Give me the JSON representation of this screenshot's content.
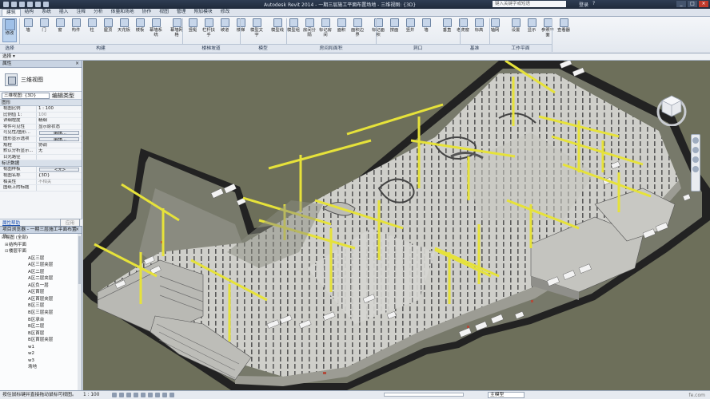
{
  "titlebar": {
    "title": "Autodesk Revit 2014 -      一期三层施工平面布置场地 - 三维视图: {3D}",
    "search_placeholder": "键入关键字或短语",
    "tools": [
      "登录",
      "?"
    ],
    "window_controls": [
      "_",
      "□",
      "×"
    ]
  },
  "tabs": [
    "建筑",
    "结构",
    "系统",
    "插入",
    "注释",
    "分析",
    "体量和场地",
    "协作",
    "视图",
    "管理",
    "附加模块",
    "修改"
  ],
  "active_tab": "建筑",
  "ribbon": {
    "modify": "修改",
    "buttons": [
      "墙",
      "门",
      "窗",
      "构件",
      "柱",
      "屋顶",
      "天花板",
      "楼板",
      "幕墙系统",
      "幕墙网格",
      "竖梃",
      "栏杆扶手",
      "坡道",
      "楼梯",
      "模型文字",
      "模型线",
      "模型组",
      "房间分隔",
      "标记房间",
      "面积",
      "面积边界",
      "标记面积",
      "按面",
      "竖井",
      "墙",
      "垂直",
      "老虎窗",
      "标高",
      "轴网",
      "设置",
      "显示",
      "参照平面",
      "查看器"
    ],
    "groups": [
      "选择",
      "构建",
      "楼梯坡道",
      "模型",
      "房间和面积",
      "洞口",
      "基准",
      "工作平面"
    ]
  },
  "optbar": {
    "label": "选择 ▾"
  },
  "properties": {
    "header": "属性",
    "type_name": "三维视图",
    "selector": "三维视图: {3D}",
    "edit_type": "编辑类型",
    "sections": [
      {
        "name": "图形",
        "rows": [
          {
            "k": "视图比例",
            "v": "1 : 100"
          },
          {
            "k": "比例值 1:",
            "v": "100",
            "dim": true
          },
          {
            "k": "详细程度",
            "v": "精细"
          },
          {
            "k": "零件可见性",
            "v": "显示原状态"
          },
          {
            "k": "可见性/图形...",
            "v": "编辑...",
            "btn": true
          },
          {
            "k": "图形显示选项",
            "v": "编辑...",
            "btn": true
          },
          {
            "k": "规程",
            "v": "协调"
          },
          {
            "k": "默认分析显示...",
            "v": "无"
          },
          {
            "k": "日光路径",
            "v": ""
          }
        ]
      },
      {
        "name": "标识数据",
        "rows": [
          {
            "k": "视图样板",
            "v": "<无>",
            "btn": true
          },
          {
            "k": "视图名称",
            "v": "{3D}"
          },
          {
            "k": "相关性",
            "v": "不相关",
            "dim": true
          },
          {
            "k": "图纸上的标题",
            "v": ""
          }
        ]
      }
    ],
    "help_link": "属性帮助",
    "apply": "应用"
  },
  "browser": {
    "header": "项目浏览器 - 一期三层施工平面布置场...",
    "nodes": [
      {
        "t": "视图 (全部)",
        "lvl": 0,
        "tg": "⊟"
      },
      {
        "t": "结构平面",
        "lvl": 1,
        "tg": "⊞"
      },
      {
        "t": "楼层平面",
        "lvl": 1,
        "tg": "⊟"
      },
      {
        "t": "A区三层",
        "lvl": 3,
        "tg": ""
      },
      {
        "t": "A区三层夹层",
        "lvl": 3,
        "tg": ""
      },
      {
        "t": "A区二层",
        "lvl": 3,
        "tg": ""
      },
      {
        "t": "A区二层夹层",
        "lvl": 3,
        "tg": ""
      },
      {
        "t": "A区负一层",
        "lvl": 3,
        "tg": ""
      },
      {
        "t": "A区首层",
        "lvl": 3,
        "tg": ""
      },
      {
        "t": "A区首层夹层",
        "lvl": 3,
        "tg": ""
      },
      {
        "t": "B区三层",
        "lvl": 3,
        "tg": ""
      },
      {
        "t": "B区三层夹层",
        "lvl": 3,
        "tg": ""
      },
      {
        "t": "B区承台",
        "lvl": 3,
        "tg": ""
      },
      {
        "t": "B区二层",
        "lvl": 3,
        "tg": ""
      },
      {
        "t": "B区首层",
        "lvl": 3,
        "tg": ""
      },
      {
        "t": "B区首层夹层",
        "lvl": 3,
        "tg": ""
      },
      {
        "t": "w1",
        "lvl": 3,
        "tg": ""
      },
      {
        "t": "w2",
        "lvl": 3,
        "tg": ""
      },
      {
        "t": "w3",
        "lvl": 3,
        "tg": ""
      },
      {
        "t": "场地",
        "lvl": 3,
        "tg": ""
      }
    ]
  },
  "status": {
    "message": "按住鼠标键并直接拖动鼠标可视图。",
    "scale": "1 : 100",
    "model": "主模型",
    "watermark": "fe.com"
  },
  "colors": {
    "crane": "#e6e23a",
    "slab": "#d3d3cf",
    "ground": "#6d6f5a",
    "road": "#232323"
  }
}
